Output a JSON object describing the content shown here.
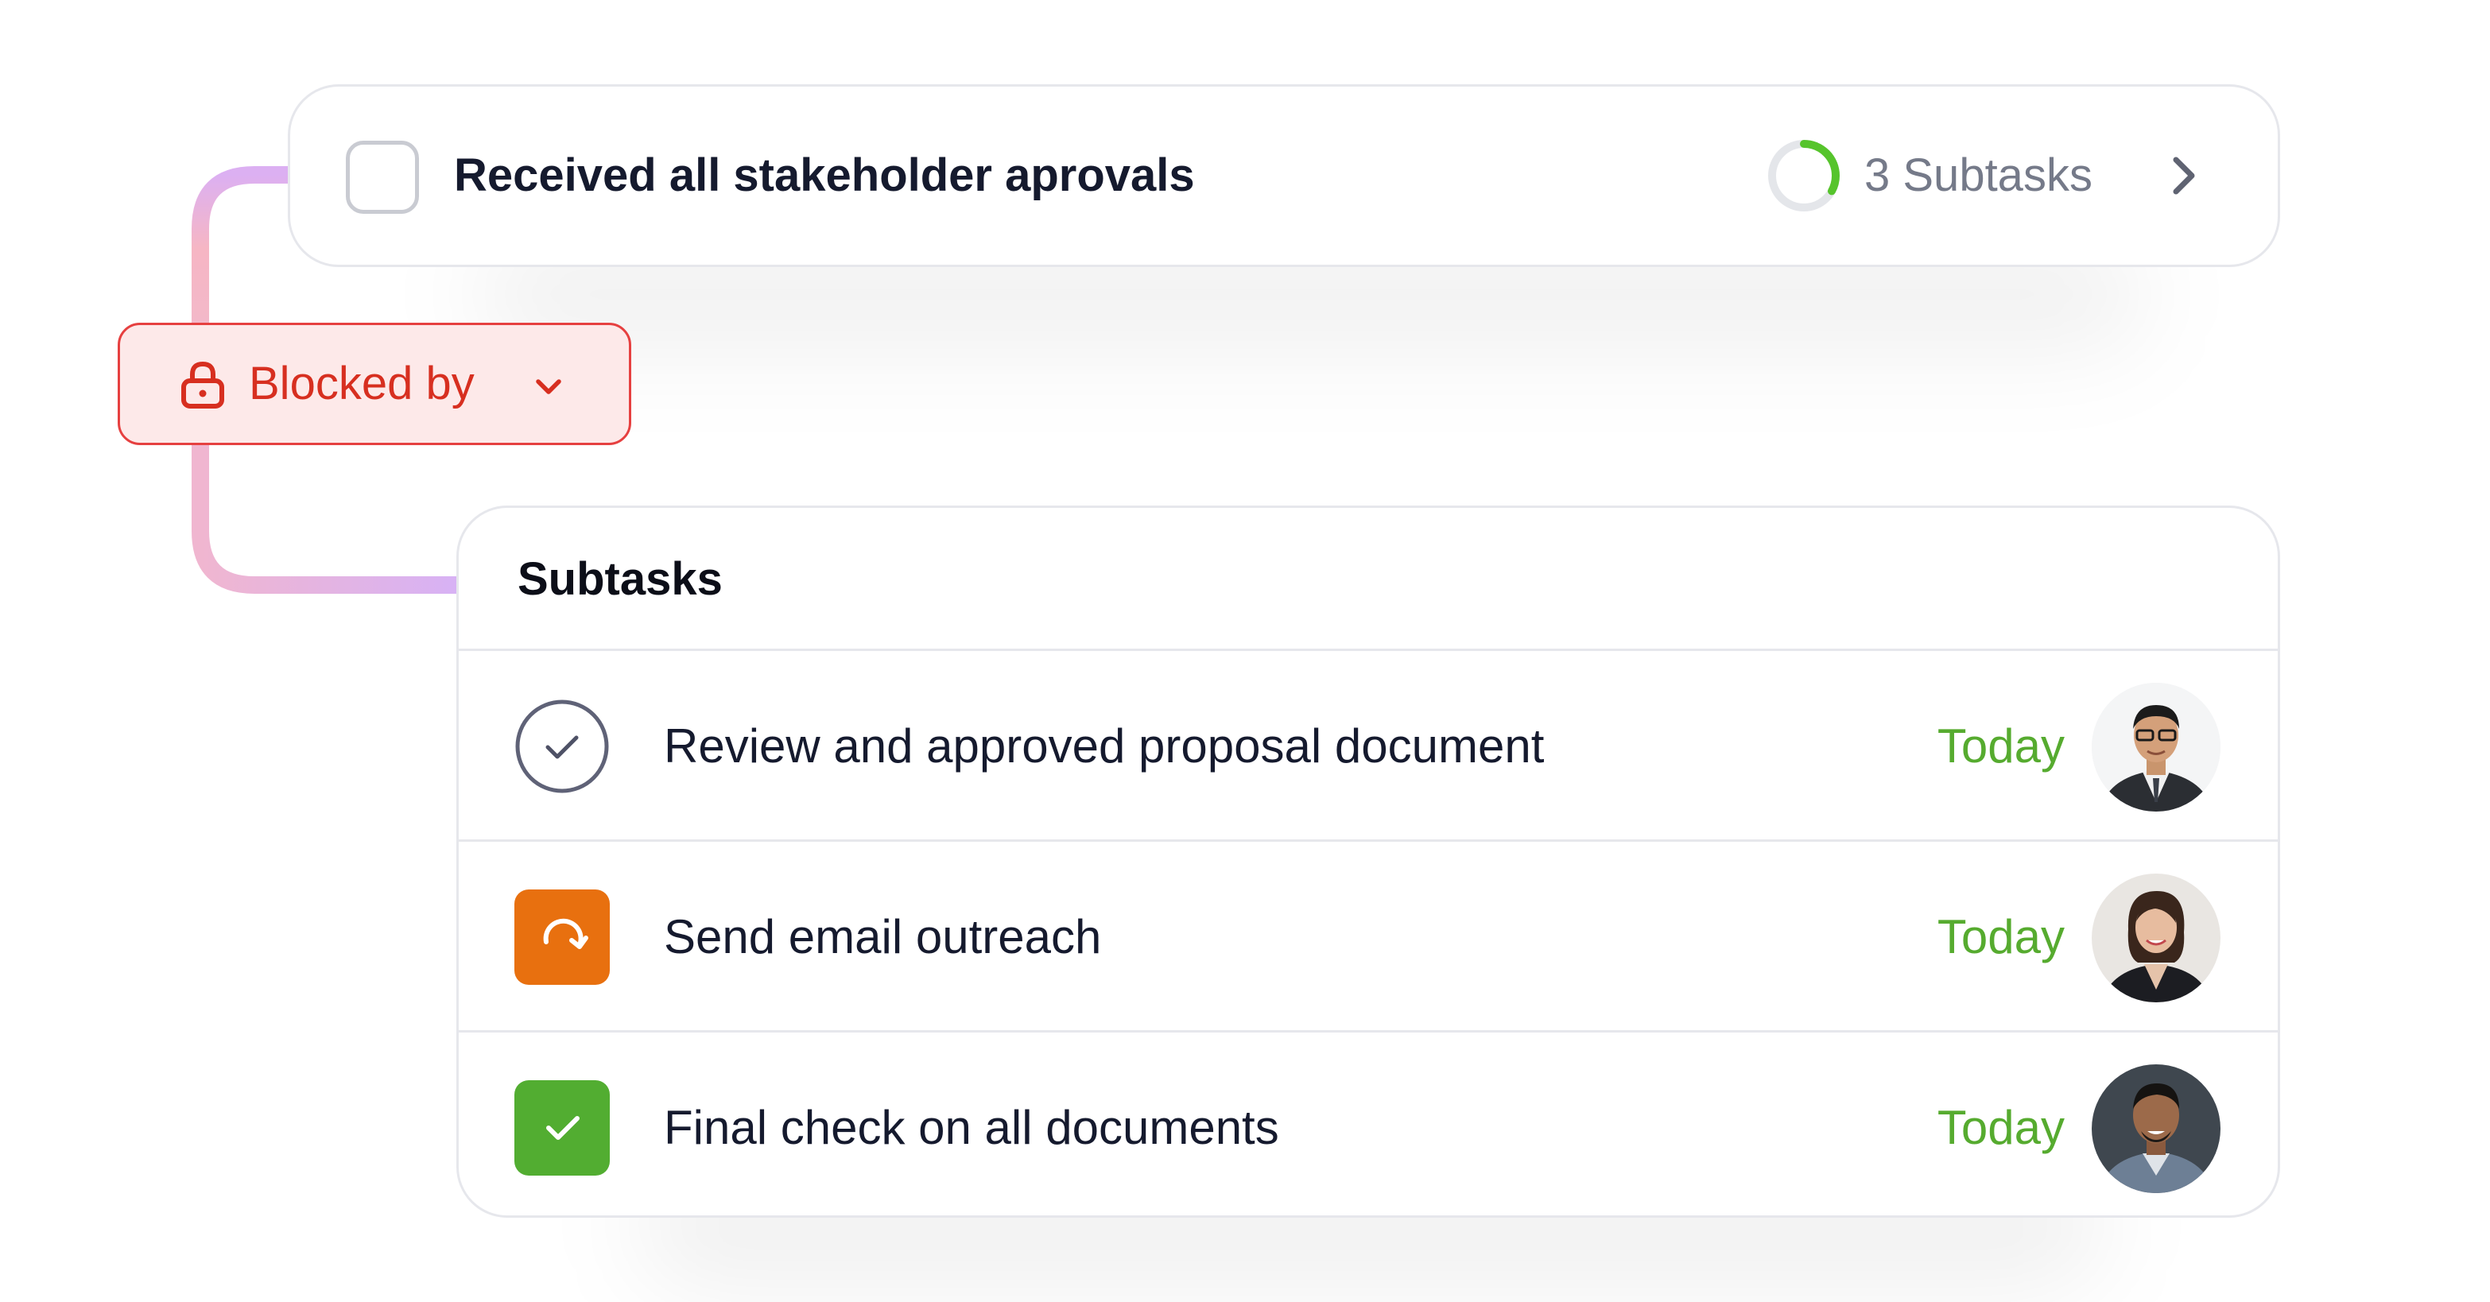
{
  "task": {
    "title": "Received all stakeholder aprovals",
    "subtask_count_label": "3 Subtasks",
    "progress": 0.33
  },
  "dependency": {
    "label": "Blocked by"
  },
  "subtasks": {
    "title": "Subtasks",
    "items": [
      {
        "label": "Review and approved proposal document",
        "due": "Today",
        "status": "in-review"
      },
      {
        "label": "Send email outreach",
        "due": "Today",
        "status": "in-progress"
      },
      {
        "label": "Final check on all documents",
        "due": "Today",
        "status": "done"
      }
    ]
  },
  "colors": {
    "accent_green": "#56ab2f",
    "blocked_red": "#d72f20",
    "in_progress_orange": "#e8700f",
    "done_green": "#52ad31",
    "connector_pink": "#f5b8c6",
    "connector_purple": "#d9b3f2"
  }
}
